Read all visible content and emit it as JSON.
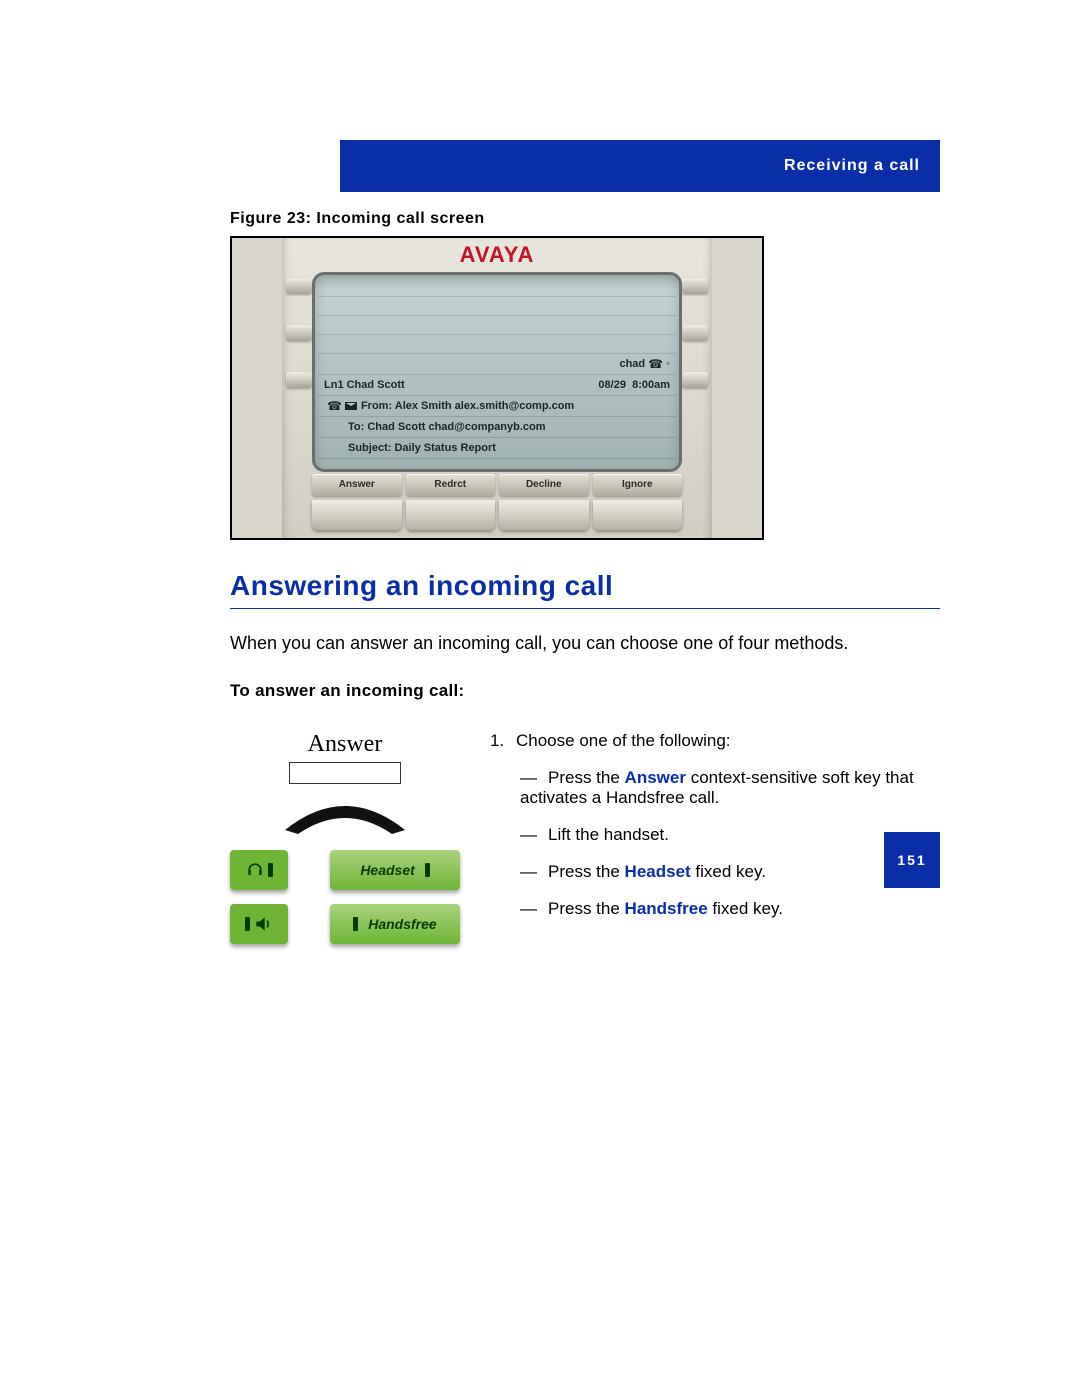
{
  "header": {
    "section_title": "Receiving a call"
  },
  "figure": {
    "caption": "Figure 23: Incoming call screen",
    "brand": "AVAYA",
    "status_right": "chad",
    "line1": {
      "left": "Ln1  Chad Scott",
      "date": "08/29",
      "time": "8:00am"
    },
    "line2": "From: Alex Smith  alex.smith@comp.com",
    "line3": "To: Chad Scott  chad@companyb.com",
    "line4": "Subject: Daily Status Report",
    "softkeys": [
      "Answer",
      "Redrct",
      "Decline",
      "Ignore"
    ]
  },
  "heading": "Answering an incoming call",
  "intro": "When you can answer an incoming call, you can choose one of four methods.",
  "subhead": "To answer an incoming call:",
  "left_panel": {
    "answer_label": "Answer",
    "headset_label": "Headset",
    "handsfree_label": "Handsfree"
  },
  "steps": {
    "lead": "Choose one of the following:",
    "a_prefix": "Press the ",
    "a_kw": "Answer",
    "a_suffix": " context-sensitive soft key that activates a Handsfree call.",
    "b": "Lift the handset.",
    "c_prefix": "Press the ",
    "c_kw": "Headset",
    "c_suffix": " fixed key.",
    "d_prefix": "Press the ",
    "d_kw": "Handsfree",
    "d_suffix": " fixed key."
  },
  "page_number": "151"
}
